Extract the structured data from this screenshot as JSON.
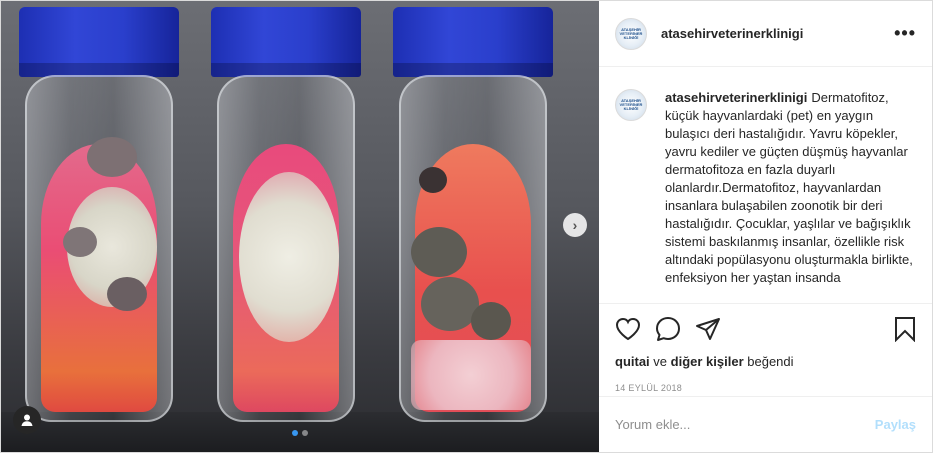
{
  "post": {
    "username": "atasehirveterinerklinigi",
    "avatar_text": "ATAŞEHİR VETERİNER KLİNİĞİ",
    "caption": "Dermatofitoz, küçük hayvanlardaki (pet) en yaygın bulaşıcı deri hastalığıdır. Yavru köpekler, yavru kediler ve güçten düşmüş hayvanlar dermatofitoza en fazla duyarlı olanlardır.Dermatofitoz, hayvanlardan insanlara bulaşabilen zoonotik bir deri hastalığıdır. Çocuklar, yaşlılar ve bağışıklık sistemi baskılanmış insanlar, özellikle risk altındaki popülasyonu oluşturmakla birlikte, enfeksiyon her yaştan insanda",
    "likes_user": "quitai",
    "likes_middle": "ve",
    "likes_others": "diğer kişiler",
    "likes_suffix": "beğendi",
    "date": "14 EYLÜL 2018",
    "more_label": "•••"
  },
  "comment": {
    "placeholder": "Yorum ekle...",
    "post_label": "Paylaş"
  },
  "icons": {
    "like": "heart-icon",
    "comment": "comment-icon",
    "share": "share-icon",
    "save": "bookmark-icon",
    "next": "chevron-right-icon",
    "tag": "user-tag-icon"
  },
  "carousel": {
    "total": 2,
    "active_index": 0
  },
  "colors": {
    "accent": "#3897f0",
    "post_disabled": "#b2dffc",
    "muted": "#8e8e8e"
  }
}
